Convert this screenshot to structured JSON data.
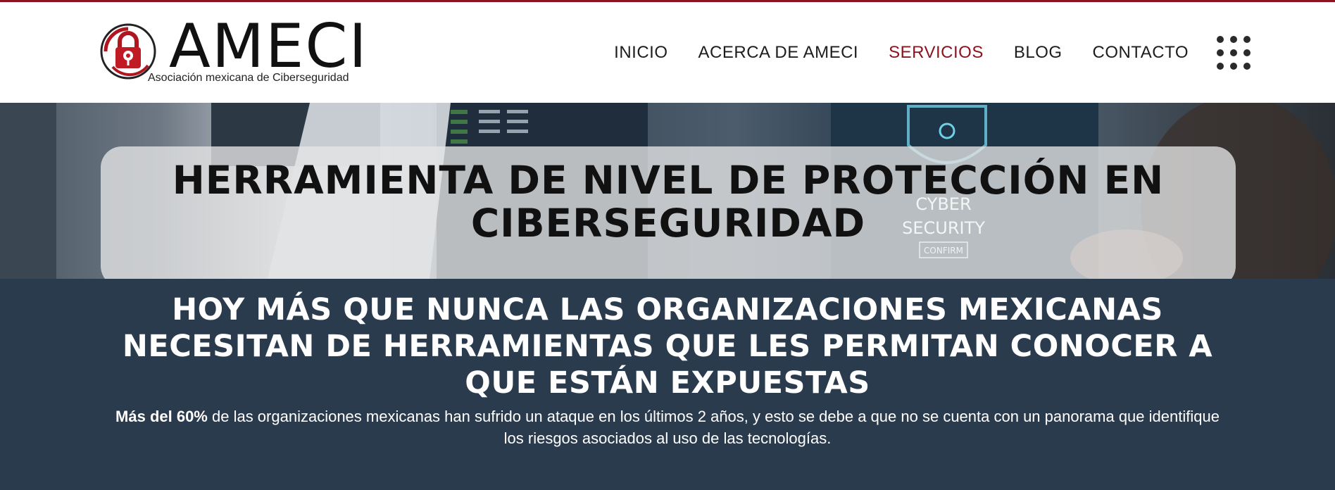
{
  "brand": {
    "name": "AMECI",
    "tagline": "Asociación mexicana de Ciberseguridad",
    "accent_color": "#8a1420",
    "dark_section_color": "#2b3b4e"
  },
  "nav": {
    "items": [
      {
        "label": "INICIO",
        "active": false
      },
      {
        "label": "ACERCA DE AMECI",
        "active": false
      },
      {
        "label": "SERVICIOS",
        "active": true
      },
      {
        "label": "BLOG",
        "active": false
      },
      {
        "label": "CONTACTO",
        "active": false
      }
    ],
    "menu_icon": "grid-dots-icon"
  },
  "hero": {
    "title": "HERRAMIENTA DE NIVEL DE PROTECCIÓN EN CIBERSEGURIDAD",
    "image_text": {
      "cyber": "CYBER",
      "security": "SECURITY",
      "confirm": "CONFIRM"
    }
  },
  "intro": {
    "heading": "HOY MÁS QUE NUNCA LAS ORGANIZACIONES MEXICANAS NECESITAN DE HERRAMIENTAS QUE LES PERMITAN CONOCER A QUE ESTÁN EXPUESTAS",
    "body_bold": "Más del 60%",
    "body_text": " de las organizaciones mexicanas han sufrido un ataque en los últimos 2 años, y esto se debe a que no se cuenta con un panorama que identifique los riesgos asociados al uso de las tecnologías."
  }
}
